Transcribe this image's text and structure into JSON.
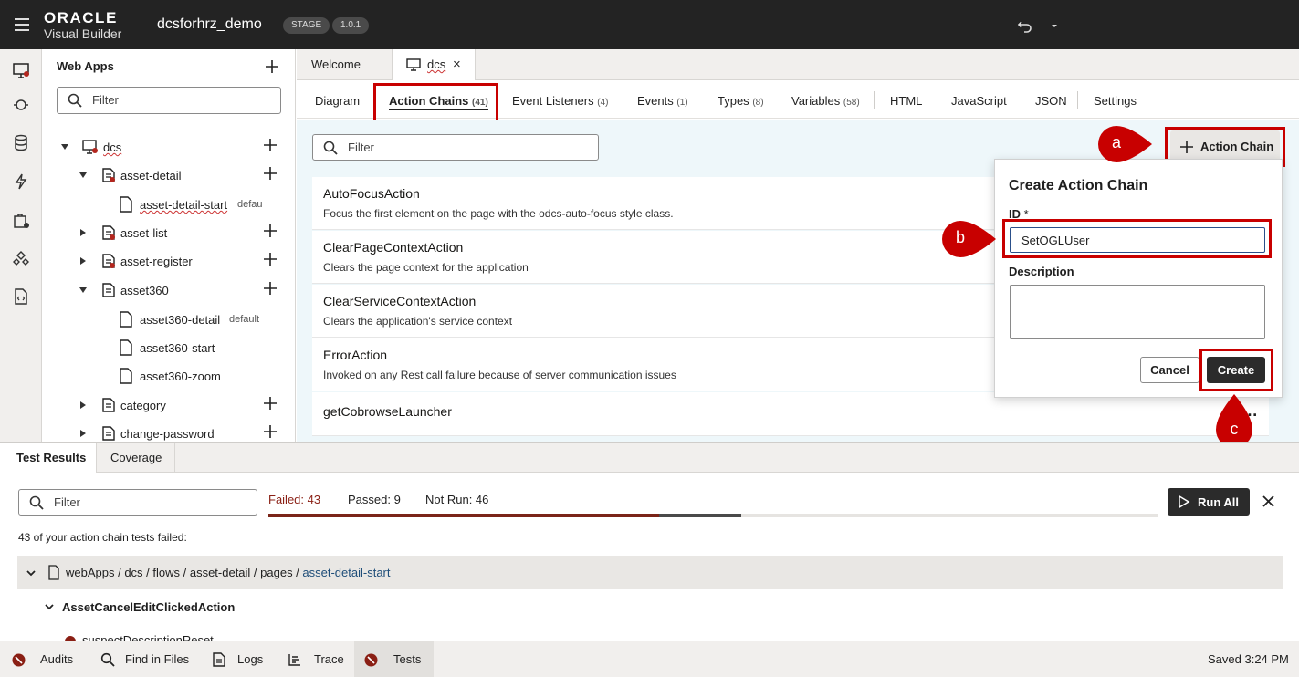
{
  "header": {
    "brand_line1": "ORACLE",
    "brand_line2": "Visual Builder",
    "app_name": "dcsforhrz_demo",
    "stage_badge": "STAGE",
    "version_badge": "1.0.1"
  },
  "rail_icons": [
    "web-apps-icon",
    "services-icon",
    "data-icon",
    "actions-icon",
    "processes-icon",
    "components-icon",
    "source-icon"
  ],
  "navigator": {
    "title": "Web Apps",
    "filter_placeholder": "Filter",
    "tree": {
      "root": "dcs",
      "asset_detail": "asset-detail",
      "asset_detail_start": "asset-detail-start",
      "asset_detail_start_tag": "defau",
      "asset_list": "asset-list",
      "asset_register": "asset-register",
      "asset360": "asset360",
      "asset360_detail": "asset360-detail",
      "asset360_detail_tag": "default",
      "asset360_start": "asset360-start",
      "asset360_zoom": "asset360-zoom",
      "category": "category",
      "change_password": "change-password"
    }
  },
  "doc_tabs": {
    "welcome": "Welcome",
    "dcs": "dcs",
    "close_glyph": "×"
  },
  "sub_tabs": [
    {
      "label": "Diagram",
      "count": ""
    },
    {
      "label": "Action Chains",
      "count": "(41)"
    },
    {
      "label": "Event Listeners",
      "count": "(4)"
    },
    {
      "label": "Events",
      "count": "(1)"
    },
    {
      "label": "Types",
      "count": "(8)"
    },
    {
      "label": "Variables",
      "count": "(58)"
    },
    {
      "label": "HTML",
      "count": ""
    },
    {
      "label": "JavaScript",
      "count": ""
    },
    {
      "label": "JSON",
      "count": ""
    },
    {
      "label": "Settings",
      "count": ""
    }
  ],
  "main": {
    "filter_placeholder": "Filter",
    "add_button": "Action Chain",
    "actions": [
      {
        "name": "AutoFocusAction",
        "desc": "Focus the first element on the page with the odcs-auto-focus style class."
      },
      {
        "name": "ClearPageContextAction",
        "desc": "Clears the page context for the application"
      },
      {
        "name": "ClearServiceContextAction",
        "desc": "Clears the application's service context"
      },
      {
        "name": "ErrorAction",
        "desc": "Invoked on any Rest call failure because of server communication issues"
      },
      {
        "name": "getCobrowseLauncher",
        "desc": ""
      }
    ],
    "more_glyph": "…"
  },
  "popup": {
    "title": "Create Action Chain",
    "id_label": "ID",
    "required_mark": "*",
    "id_value": "SetOGLUser",
    "description_label": "Description",
    "description_value": "",
    "cancel": "Cancel",
    "create": "Create"
  },
  "markers": {
    "a": "a",
    "b": "b",
    "c": "c"
  },
  "bottom": {
    "tabs": [
      "Test Results",
      "Coverage"
    ],
    "filter_placeholder": "Filter",
    "failed": "Failed: 43",
    "passed": "Passed: 9",
    "not_run": "Not Run: 46",
    "progress": {
      "failed": 43,
      "passed": 9,
      "not_run": 46
    },
    "run_all": "Run All",
    "summary": "43 of your action chain tests failed:",
    "path_prefix": "webApps / dcs / flows / asset-detail / pages / ",
    "path_leaf": "asset-detail-start",
    "test_group": "AssetCancelEditClickedAction",
    "truncated_item": "suspectDescriptionReset"
  },
  "statusbar": {
    "audits": "Audits",
    "find_in_files": "Find in Files",
    "logs": "Logs",
    "trace": "Trace",
    "tests": "Tests",
    "saved": "Saved 3:24 PM"
  },
  "colors": {
    "highlight": "#c80000",
    "header_bg": "#232323",
    "failed_bar": "#7a2418",
    "passed_bar": "#4a4a4a"
  }
}
